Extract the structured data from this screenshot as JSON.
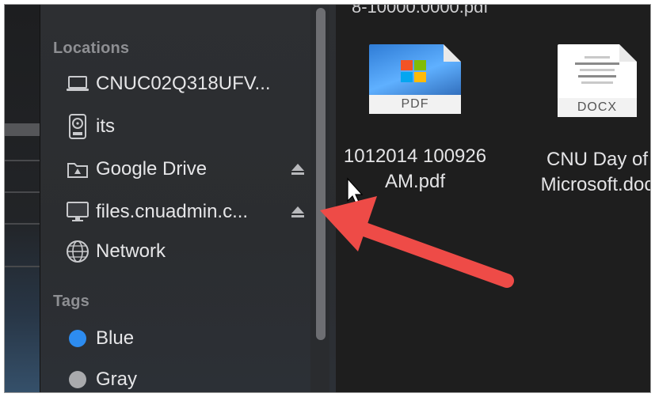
{
  "sidebar": {
    "locations_header": "Locations",
    "tags_header": "Tags",
    "locations": [
      {
        "label": "CNUC02Q318UFV...",
        "icon": "laptop-icon"
      },
      {
        "label": "its",
        "icon": "internal-disk-icon"
      },
      {
        "label": "Google Drive",
        "icon": "drive-folder-icon",
        "ejectable": true
      },
      {
        "label": "files.cnuadmin.c...",
        "icon": "network-server-icon",
        "ejectable": true
      },
      {
        "label": "Network",
        "icon": "globe-icon"
      }
    ],
    "tags": [
      {
        "label": "Blue",
        "color": "#2d8cf0"
      },
      {
        "label": "Gray",
        "color": "#a9aaad"
      }
    ]
  },
  "content": {
    "partial_filename": "8-10000.0000.pdf",
    "files": [
      {
        "badge": "PDF",
        "name_line1": "1012014 100926",
        "name_line2": "AM.pdf"
      },
      {
        "badge": "DOCX",
        "name_line1": "CNU Day of",
        "name_line2": "Microsoft.doc"
      }
    ]
  },
  "colors": {
    "annotation_arrow": "#ee4b47",
    "sidebar_bg": "#2d2f32",
    "content_bg": "#1e1e1e"
  }
}
